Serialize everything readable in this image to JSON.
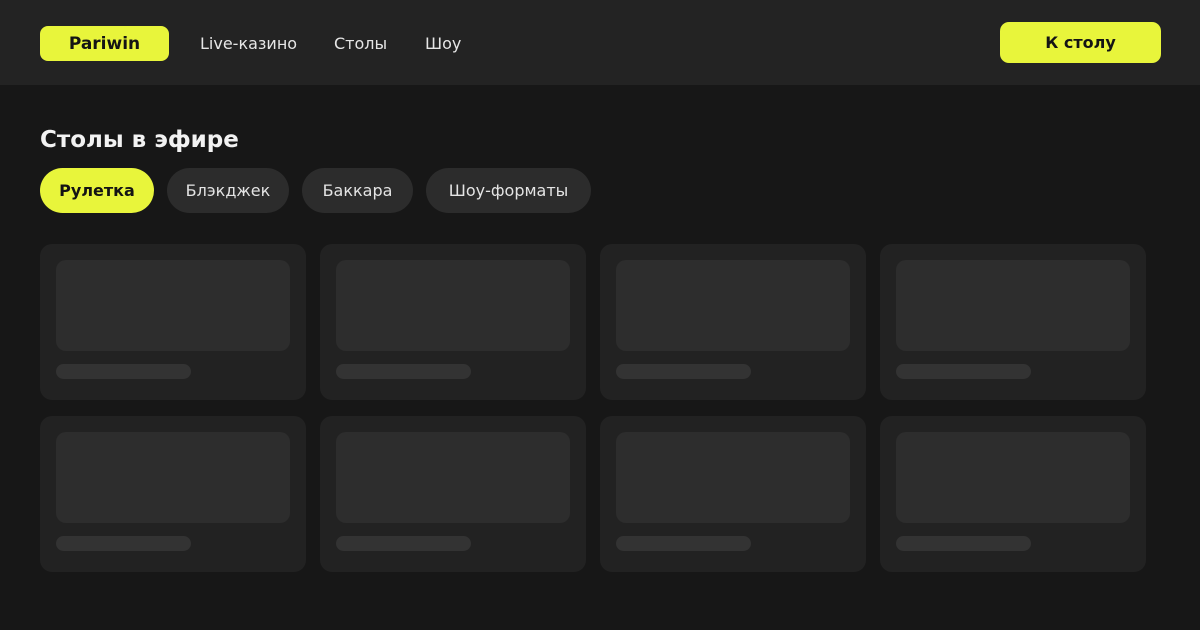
{
  "header": {
    "logo": "Pariwin",
    "nav": [
      "Live-казино",
      "Столы",
      "Шоу"
    ],
    "cta_label": "К столу"
  },
  "main": {
    "title": "Столы в эфире",
    "filters": [
      {
        "label": "Рулетка",
        "active": true
      },
      {
        "label": "Блэкджек",
        "active": false
      },
      {
        "label": "Баккара",
        "active": false
      },
      {
        "label": "Шоу-форматы",
        "active": false
      }
    ],
    "cards_state": "loading-skeleton",
    "card_count": 8
  },
  "colors": {
    "accent": "#e8f53b",
    "background": "#171717",
    "header": "#232323",
    "card": "#222222",
    "chip": "#2c2c2c"
  }
}
